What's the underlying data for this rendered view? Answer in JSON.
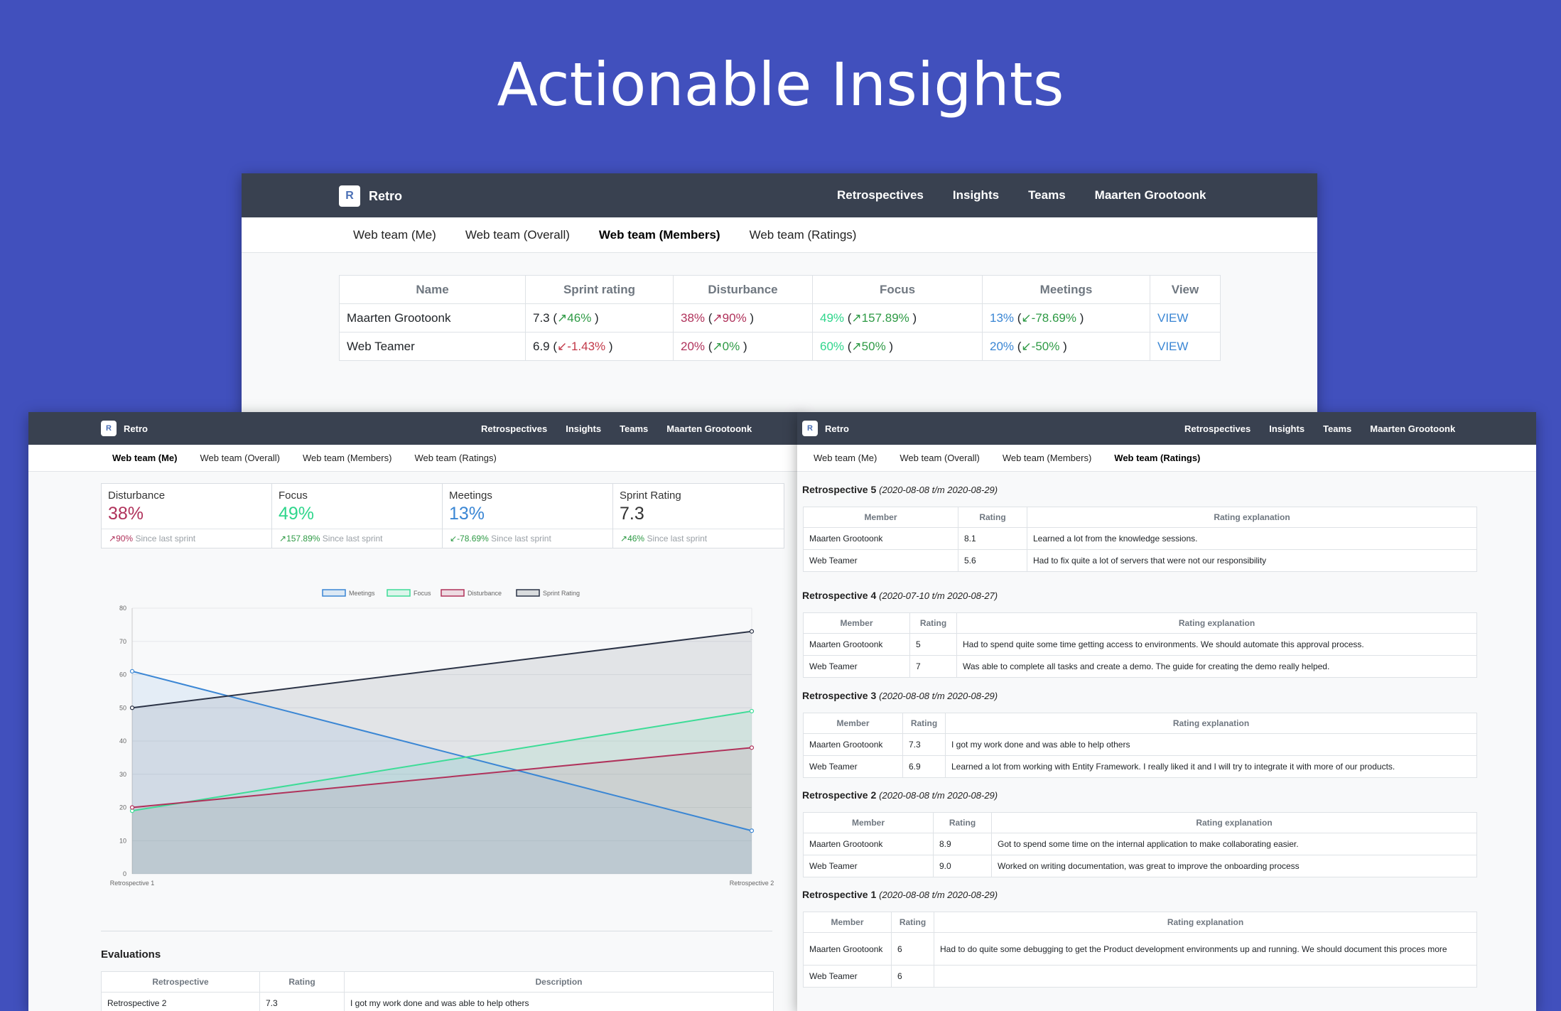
{
  "hero": {
    "title": "Actionable Insights"
  },
  "app": {
    "brand_logo": "R",
    "brand": "Retro",
    "nav": [
      "Retrospectives",
      "Insights",
      "Teams",
      "Maarten Grootoonk"
    ],
    "tabs": [
      "Web team (Me)",
      "Web team (Overall)",
      "Web team (Members)",
      "Web team (Ratings)"
    ]
  },
  "members": {
    "headers": [
      "Name",
      "Sprint rating",
      "Disturbance",
      "Focus",
      "Meetings",
      "View"
    ],
    "rows": [
      {
        "name": "Maarten Grootoonk",
        "rating": "7.3",
        "rating_arrow": "↗",
        "rating_trend": "46%",
        "disturbance": "38%",
        "disturbance_arrow": "↗",
        "disturbance_trend": "90%",
        "focus": "49%",
        "focus_arrow": "↗",
        "focus_trend": "157.89%",
        "meetings": "13%",
        "meetings_arrow": "↙",
        "meetings_trend": "-78.69%",
        "view": "VIEW"
      },
      {
        "name": "Web Teamer",
        "rating": "6.9",
        "rating_arrow": "↙",
        "rating_trend": "-1.43%",
        "disturbance": "20%",
        "disturbance_arrow": "↗",
        "disturbance_trend": "0%",
        "focus": "60%",
        "focus_arrow": "↗",
        "focus_trend": "50%",
        "meetings": "20%",
        "meetings_arrow": "↙",
        "meetings_trend": "-50%",
        "view": "VIEW"
      }
    ]
  },
  "cards": [
    {
      "title": "Disturbance",
      "value": "38%",
      "arrow": "↗",
      "trend": "90%",
      "since": "Since last sprint"
    },
    {
      "title": "Focus",
      "value": "49%",
      "arrow": "↗",
      "trend": "157.89%",
      "since": "Since last sprint"
    },
    {
      "title": "Meetings",
      "value": "13%",
      "arrow": "↙",
      "trend": "-78.69%",
      "since": "Since last sprint"
    },
    {
      "title": "Sprint Rating",
      "value": "7.3",
      "arrow": "↗",
      "trend": "46%",
      "since": "Since last sprint"
    }
  ],
  "chart_data": {
    "type": "area",
    "x": [
      "Retrospective 1",
      "Retrospective 2"
    ],
    "ylim": [
      0,
      80
    ],
    "yticks": [
      0,
      10,
      20,
      30,
      40,
      50,
      60,
      70,
      80
    ],
    "legend_position": "top",
    "series": [
      {
        "name": "Meetings",
        "values": [
          61,
          13
        ],
        "color": "#3a86d4"
      },
      {
        "name": "Focus",
        "values": [
          19,
          49
        ],
        "color": "#3ddc97"
      },
      {
        "name": "Disturbance",
        "values": [
          20,
          38
        ],
        "color": "#b0325b"
      },
      {
        "name": "Sprint Rating",
        "values": [
          50,
          73
        ],
        "color": "#2b3346"
      }
    ]
  },
  "evaluations": {
    "title": "Evaluations",
    "headers": [
      "Retrospective",
      "Rating",
      "Description"
    ],
    "rows": [
      {
        "retro": "Retrospective 2",
        "rating": "7.3",
        "description": "I got my work done and was able to help others"
      }
    ]
  },
  "ratings": {
    "headers": [
      "Member",
      "Rating",
      "Rating explanation"
    ],
    "retros": [
      {
        "title": "Retrospective 5",
        "range": "(2020-08-08 t/m 2020-08-29)",
        "rows": [
          {
            "member": "Maarten Grootoonk",
            "rating": "8.1",
            "explanation": "Learned a lot from the knowledge sessions."
          },
          {
            "member": "Web Teamer",
            "rating": "5.6",
            "explanation": "Had to fix quite a lot of servers that were not our responsibility"
          }
        ]
      },
      {
        "title": "Retrospective 4",
        "range": "(2020-07-10 t/m 2020-08-27)",
        "rows": [
          {
            "member": "Maarten Grootoonk",
            "rating": "5",
            "explanation": "Had to spend quite some time getting access to environments. We should automate this approval process."
          },
          {
            "member": "Web Teamer",
            "rating": "7",
            "explanation": "Was able to complete all tasks and create a demo. The guide for creating the demo really helped."
          }
        ]
      },
      {
        "title": "Retrospective 3",
        "range": "(2020-08-08 t/m 2020-08-29)",
        "rows": [
          {
            "member": "Maarten Grootoonk",
            "rating": "7.3",
            "explanation": "I got my work done and was able to help others"
          },
          {
            "member": "Web Teamer",
            "rating": "6.9",
            "explanation": "Learned a lot from working with Entity Framework. I really liked it and I will try to integrate it with more of our products."
          }
        ]
      },
      {
        "title": "Retrospective 2",
        "range": "(2020-08-08 t/m 2020-08-29)",
        "rows": [
          {
            "member": "Maarten Grootoonk",
            "rating": "8.9",
            "explanation": "Got to spend some time on the internal application to make collaborating easier."
          },
          {
            "member": "Web Teamer",
            "rating": "9.0",
            "explanation": "Worked on writing documentation, was great to improve the onboarding process"
          }
        ]
      },
      {
        "title": "Retrospective 1",
        "range": "(2020-08-08 t/m 2020-08-29)",
        "rows": [
          {
            "member": "Maarten Grootoonk",
            "rating": "6",
            "explanation": "Had to do quite some debugging to get the Product development environments up and running. We should document this proces more"
          },
          {
            "member": "Web Teamer",
            "rating": "6",
            "explanation": ""
          }
        ]
      }
    ]
  }
}
